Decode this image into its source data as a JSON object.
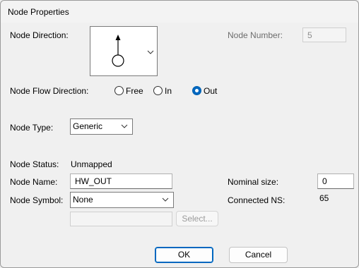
{
  "window": {
    "title": "Node Properties"
  },
  "node_direction": {
    "label": "Node Direction:",
    "icon": "node-arrow-up-icon"
  },
  "node_number": {
    "label": "Node Number:",
    "value": "5"
  },
  "flow_direction": {
    "label": "Node Flow Direction:",
    "options": [
      {
        "label": "Free",
        "selected": false
      },
      {
        "label": "In",
        "selected": false
      },
      {
        "label": "Out",
        "selected": true
      }
    ]
  },
  "node_type": {
    "label": "Node Type:",
    "value": "Generic"
  },
  "node_status": {
    "label": "Node Status:",
    "value": "Unmapped"
  },
  "node_name": {
    "label": "Node Name:",
    "value": "HW_OUT"
  },
  "nominal_size": {
    "label": "Nominal size:",
    "value": "0"
  },
  "node_symbol": {
    "label": "Node Symbol:",
    "value": "None",
    "select_label": "Select..."
  },
  "connected_ns": {
    "label": "Connected NS:",
    "value": "65"
  },
  "buttons": {
    "ok": "OK",
    "cancel": "Cancel"
  },
  "colors": {
    "accent": "#0067c0",
    "background": "#f0f0f0"
  }
}
